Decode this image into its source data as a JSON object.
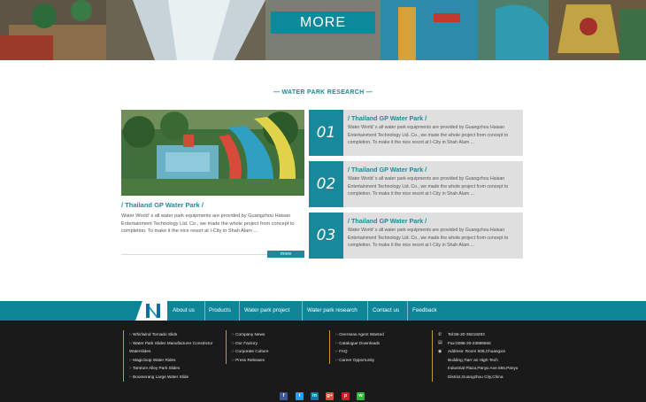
{
  "hero": {
    "more_label": "MORE",
    "colors": {
      "more_bg": "#0b8a9b"
    }
  },
  "section": {
    "title": "— WATER PARK RESEARCH —"
  },
  "feature": {
    "title": "/ Thailand GP Water Park /",
    "text": "Water World’ s all water park equipments are provided by Guangzhou Haisan Entertainment Technology Ltd. Co., we made the whole project from concept to completion. To make it the nice resort at I-City in Shah Alam ...",
    "more_label": "more"
  },
  "news": [
    {
      "number": "01",
      "title": "/ Thailand GP Water Park /",
      "text": "Water World’ s all water park equipments are provided by Guangzhou Haisan Entertainment Technology Ltd. Co., we made the whole project from concept to completion. To make it the nice resort at I-City in Shah Alam ..."
    },
    {
      "number": "02",
      "title": "/ Thailand GP Water Park /",
      "text": "Water World’ s all water park equipments are provided by Guangzhou Haisan Entertainment Technology Ltd. Co., we made the whole project from concept to completion. To make it the nice resort at I-City in Shah Alam ..."
    },
    {
      "number": "03",
      "title": "/ Thailand GP Water Park /",
      "text": "Water World’ s all water park equipments are provided by Guangzhou Haisan Entertainment Technology Ltd. Co., we made the whole project from concept to completion. To make it the nice resort at I-City in Shah Alam ..."
    }
  ],
  "nav": {
    "logo_icon": "brand-logo-icon",
    "items": [
      "About us",
      "Products",
      "Water park project",
      "Water park research",
      "Contact us",
      "Feedback"
    ]
  },
  "footer": {
    "col1": [
      ":- Whirlwind Tornado Slide",
      ":- Water Park Slides Manufacturer Constrictor",
      "Waterslides",
      ":- Magicloop Water Rides",
      ":- Tantrum Alley Park Slides",
      ":- Boomerang Large Water Slide"
    ],
    "col2": [
      ":- Company News",
      ":- Our Factory",
      ":- Corporate Culture",
      ":- Press Releases"
    ],
    "col3": [
      ":- Overseas Agent Wanted",
      ":- Catalogue Downloads",
      ":- FAQ",
      ":- Career Opportunity"
    ],
    "contact": {
      "tel": "Tel:86-20-39218293",
      "fax": "Fax:0086-20-23889566",
      "address_lines": [
        "Address: Room 508,Chuangxin",
        "Building,Tian’ an High-Tech",
        "Industrial Plaza,Panyu Ave.555,Panyu",
        "District,Guangzhou City,China"
      ]
    },
    "social": [
      {
        "icon": "facebook-icon",
        "glyph": "f",
        "color": "#3b5998"
      },
      {
        "icon": "twitter-icon",
        "glyph": "t",
        "color": "#1da1f2"
      },
      {
        "icon": "linkedin-icon",
        "glyph": "in",
        "color": "#0e76a8"
      },
      {
        "icon": "google-plus-icon",
        "glyph": "g+",
        "color": "#dd4b39"
      },
      {
        "icon": "pinterest-icon",
        "glyph": "p",
        "color": "#cb2027"
      },
      {
        "icon": "wechat-icon",
        "glyph": "w",
        "color": "#2dbb3b"
      }
    ]
  },
  "colors": {
    "accent": "#0d8597",
    "footer_bg": "#1a1a1a",
    "footer_border": "#c79b2a"
  }
}
